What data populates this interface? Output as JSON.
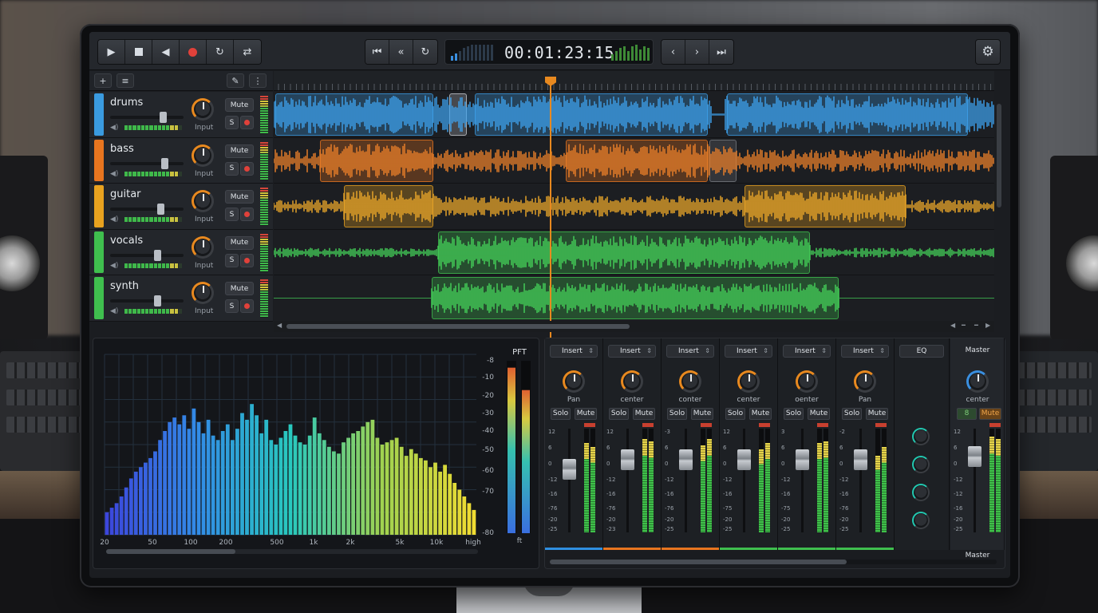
{
  "transport": {
    "timecode": "00:01:23:15",
    "buttons": [
      "play-icon",
      "stop-icon",
      "rewind-to-start-icon",
      "record-icon",
      "loop-icon",
      "cycle-icon"
    ],
    "nav_buttons": [
      "skip-to-start-icon",
      "fast-rewind-icon",
      "return-icon"
    ],
    "marker_buttons": [
      "previous-marker-icon",
      "next-marker-icon",
      "skip-to-end-icon"
    ]
  },
  "toolbar": {
    "add": "+",
    "list": "≡",
    "pencil": "✎",
    "more": "⋮"
  },
  "tracks": [
    {
      "name": "drums",
      "color": "#3a9be0",
      "input_label": "Input",
      "mute_label": "Mute",
      "solo_label": "S"
    },
    {
      "name": "bass",
      "color": "#e8751f",
      "input_label": "Input",
      "mute_label": "Mute",
      "solo_label": "S"
    },
    {
      "name": "guitar",
      "color": "#e8a21f",
      "input_label": "Input",
      "mute_label": "Mute",
      "solo_label": "S"
    },
    {
      "name": "vocals",
      "color": "#3fbf4e",
      "input_label": "Input",
      "mute_label": "Mute",
      "solo_label": "S"
    },
    {
      "name": "synth",
      "color": "#3fbf4e",
      "input_label": "Input",
      "mute_label": "Mute",
      "solo_label": "S"
    }
  ],
  "analyzer": {
    "title": "PFT",
    "x_ticks": [
      "20",
      "50",
      "100",
      "200",
      "500",
      "1k",
      "2k",
      "5k",
      "10k",
      "high"
    ],
    "y_ticks": [
      "-8",
      "-10",
      "-20",
      "-30",
      "-40",
      "-50",
      "-60",
      "-70",
      "-80"
    ],
    "meter_label": "ft"
  },
  "chart_data": {
    "type": "bar",
    "title": "PFT",
    "x_tick_labels": [
      "20",
      "50",
      "100",
      "200",
      "500",
      "1k",
      "2k",
      "5k",
      "10k",
      "high"
    ],
    "y_tick_labels": [
      "-8",
      "-10",
      "-20",
      "-30",
      "-40",
      "-50",
      "-60",
      "-70",
      "-80"
    ],
    "ylim": [
      -80,
      0
    ],
    "values": [
      -70,
      -68,
      -66,
      -63,
      -59,
      -55,
      -52,
      -50,
      -48,
      -46,
      -43,
      -38,
      -34,
      -30,
      -28,
      -31,
      -27,
      -33,
      -24,
      -30,
      -35,
      -29,
      -36,
      -38,
      -34,
      -31,
      -38,
      -33,
      -26,
      -29,
      -22,
      -27,
      -35,
      -29,
      -38,
      -40,
      -37,
      -34,
      -31,
      -36,
      -39,
      -40,
      -36,
      -28,
      -35,
      -38,
      -41,
      -43,
      -44,
      -39,
      -37,
      -35,
      -34,
      -32,
      -30,
      -29,
      -37,
      -40,
      -39,
      -38,
      -37,
      -41,
      -45,
      -42,
      -44,
      -46,
      -47,
      -50,
      -48,
      -52,
      -49,
      -53,
      -57,
      -60,
      -63,
      -66,
      -69
    ]
  },
  "mixer": {
    "channels": [
      {
        "insert": "Insert",
        "pan_label": "Pan",
        "solo": "Solo",
        "mute": "Mute",
        "color": "#2f8fe0",
        "fader_db": 0,
        "meter": [
          0.86,
          0.82
        ],
        "scale": [
          "12",
          "6",
          "0",
          "-12",
          "-16",
          "-76",
          "-20",
          "-25"
        ]
      },
      {
        "insert": "Insert",
        "pan_label": "center",
        "solo": "Solo",
        "mute": "Mute",
        "color": "#e8751f",
        "fader_db": 3,
        "meter": [
          0.9,
          0.88
        ],
        "scale": [
          "12",
          "6",
          "0",
          "-12",
          "-16",
          "-76",
          "-20",
          "-23"
        ]
      },
      {
        "insert": "Insert",
        "pan_label": "conter",
        "solo": "Solo",
        "mute": "Mute",
        "color": "#e8751f",
        "fader_db": 3,
        "meter": [
          0.84,
          0.9
        ],
        "scale": [
          "-3",
          "6",
          "0",
          "-12",
          "-16",
          "-76",
          "-20",
          "-25"
        ]
      },
      {
        "insert": "Insert",
        "pan_label": "center",
        "solo": "Solo",
        "mute": "Mute",
        "color": "#3fbf4e",
        "fader_db": 3,
        "meter": [
          0.8,
          0.86
        ],
        "scale": [
          "12",
          "6",
          "0",
          "-12",
          "-16",
          "-75",
          "-20",
          "-25"
        ]
      },
      {
        "insert": "Insert",
        "pan_label": "oenter",
        "solo": "Solo",
        "mute": "Mute",
        "color": "#3fbf4e",
        "fader_db": 3,
        "meter": [
          0.86,
          0.88
        ],
        "scale": [
          "3",
          "6",
          "0",
          "-12",
          "-16",
          "-75",
          "-20",
          "-25"
        ]
      },
      {
        "insert": "Insert",
        "pan_label": "Pan",
        "solo": "Solo",
        "mute": "Mute",
        "color": "#3fbf4e",
        "fader_db": 3,
        "meter": [
          0.74,
          0.82
        ],
        "scale": [
          "-2",
          "6",
          "0",
          "-12",
          "-16",
          "-76",
          "-20",
          "-25"
        ]
      }
    ],
    "eq_label": "EQ",
    "master": {
      "title": "Master",
      "pan_label": "center",
      "solo": "8",
      "mute": "Mute",
      "footer": "Master",
      "meter": [
        0.92,
        0.9
      ],
      "scale": [
        "12",
        "6",
        "0",
        "-12",
        "-12",
        "-16",
        "-20",
        "-25"
      ]
    }
  }
}
